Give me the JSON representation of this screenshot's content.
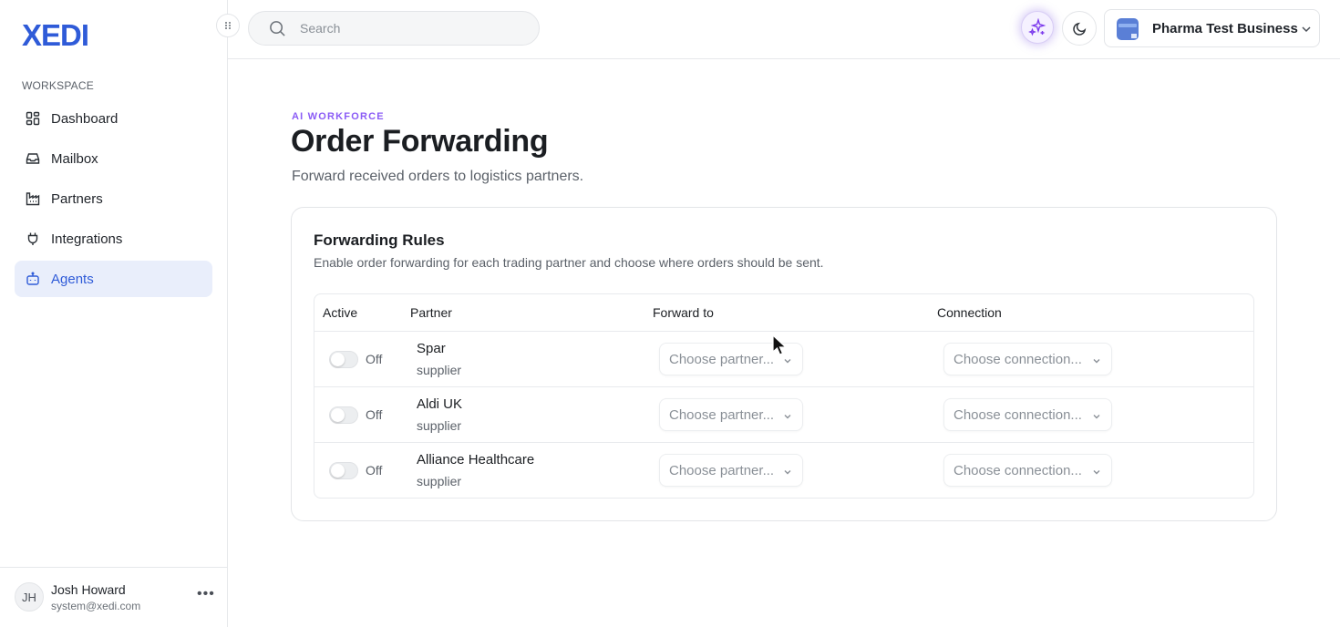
{
  "brand": {
    "logo_text": "XEDI",
    "color": "#2f5bd8"
  },
  "sidebar": {
    "section_label": "WORKSPACE",
    "items": [
      {
        "label": "Dashboard",
        "icon": "dashboard-icon",
        "active": false
      },
      {
        "label": "Mailbox",
        "icon": "inbox-icon",
        "active": false
      },
      {
        "label": "Partners",
        "icon": "factory-icon",
        "active": false
      },
      {
        "label": "Integrations",
        "icon": "plug-icon",
        "active": false
      },
      {
        "label": "Agents",
        "icon": "bot-icon",
        "active": true
      }
    ],
    "user": {
      "initials": "JH",
      "name": "Josh Howard",
      "email": "system@xedi.com"
    }
  },
  "topbar": {
    "search_placeholder": "Search",
    "business_name": "Pharma Test Business"
  },
  "page": {
    "eyebrow": "AI WORKFORCE",
    "title": "Order Forwarding",
    "subtitle": "Forward received orders to logistics partners."
  },
  "card": {
    "title": "Forwarding Rules",
    "description": "Enable order forwarding for each trading partner and choose where orders should be sent.",
    "columns": [
      "Active",
      "Partner",
      "Forward to",
      "Connection"
    ],
    "rows": [
      {
        "toggle": "Off",
        "name": "Spar",
        "type": "supplier",
        "forward_to": "Choose partner...",
        "connection": "Choose connection..."
      },
      {
        "toggle": "Off",
        "name": "Aldi UK",
        "type": "supplier",
        "forward_to": "Choose partner...",
        "connection": "Choose connection..."
      },
      {
        "toggle": "Off",
        "name": "Alliance Healthcare",
        "type": "supplier",
        "forward_to": "Choose partner...",
        "connection": "Choose connection..."
      }
    ]
  },
  "colors": {
    "accent": "#2f5bd8",
    "eyebrow": "#8b5cf6",
    "active_nav_bg": "#e9eefb"
  }
}
